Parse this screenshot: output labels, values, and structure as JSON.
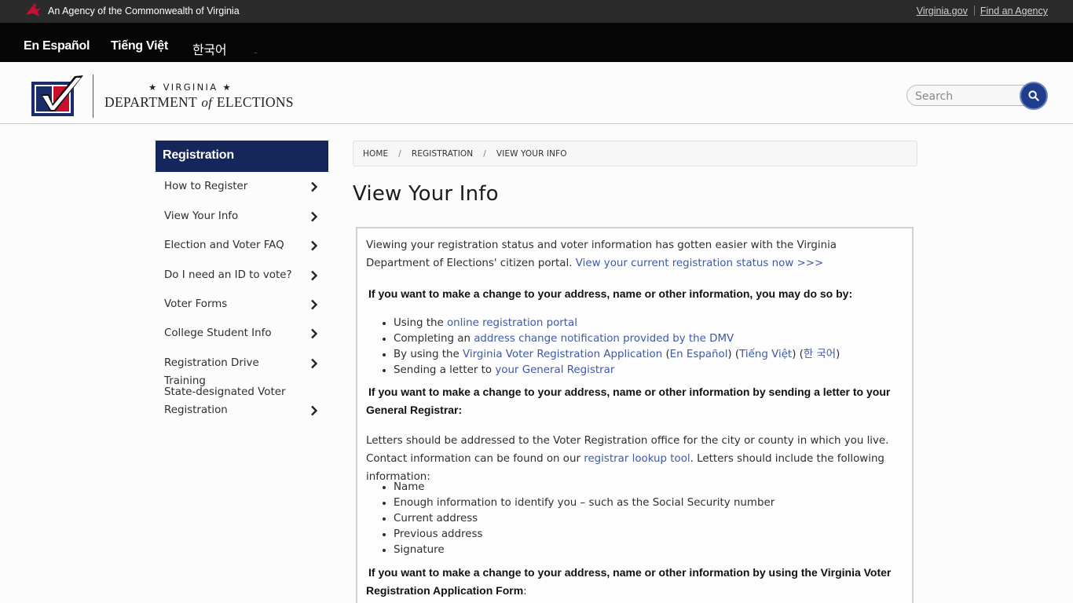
{
  "agency_bar": {
    "text": "An Agency of the Commonwealth of Virginia",
    "link_virginia": "Virginia.gov",
    "link_find": "Find an Agency"
  },
  "lang_bar": {
    "espanol": "En Español",
    "tiengviet": "Tiếng Việt",
    "korean": "한국어"
  },
  "header": {
    "logo_top": "★ VIRGINIA ★",
    "logo_dept": "DEPARTMENT",
    "logo_of": "of",
    "logo_elections": "ELECTIONS",
    "search_placeholder": "Search"
  },
  "sidebar": {
    "title": "Registration",
    "items": [
      {
        "label": "How to Register"
      },
      {
        "label": "View Your Info"
      },
      {
        "label": "Election and Voter FAQ"
      },
      {
        "label": "Do I need an ID to vote?"
      },
      {
        "label": "Voter Forms"
      },
      {
        "label": "College Student Info"
      },
      {
        "label": "Registration Drive Training"
      },
      {
        "label": "State-designated Voter Registration"
      }
    ]
  },
  "breadcrumb": {
    "home": "HOME",
    "sep": "/",
    "registration": "REGISTRATION",
    "current": "VIEW YOUR INFO"
  },
  "page_title": "View Your Info",
  "content": {
    "intro_text": "Viewing your registration status and voter information has gotten easier with the Virginia Department of Elections' citizen portal.",
    "intro_link": "View your current registration status now >>>",
    "heading1": "If you want to make a change to your address, name or other information, you may do so by:",
    "list1": {
      "item1_text": "Using the",
      "item1_link": "online registration portal",
      "item2_text": "Completing an",
      "item2_link": "address change notification provided by the DMV",
      "item3_text": "By using the",
      "item3_link": "Virginia Voter Registration Application",
      "item3_es": "En Español",
      "item3_vi": "Tiếng Việt",
      "item3_ko": "한 국어",
      "item4_text": "Sending a letter to",
      "item4_link": "your General Registrar"
    },
    "heading2": "If you want to make a change to your address, name or other information by sending a letter to your General Registrar:",
    "letters_text_a": "Letters should be addressed to the Voter Registration office for the city or county in which you live. Contact information can be found on our",
    "letters_link": "registrar lookup tool",
    "letters_text_b": ". Letters should include the following information:",
    "list2": [
      "Name",
      "Enough information to identify you – such as the Social Security number",
      "Current address",
      "Previous address",
      "Signature"
    ],
    "heading3": "If you want to make a change to your address, name or other information by using the Virginia Voter Registration Application Form",
    "heading3_colon": ":"
  },
  "colors": {
    "navy": "#15265a",
    "link": "#3c5aa6",
    "search_btn": "#1e3d8a",
    "logo_red": "#c8102e"
  }
}
